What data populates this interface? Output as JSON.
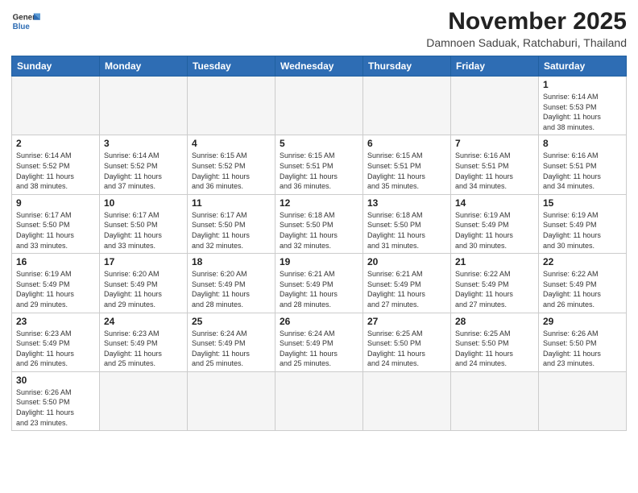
{
  "header": {
    "logo_line1": "General",
    "logo_line2": "Blue",
    "month_title": "November 2025",
    "location": "Damnoen Saduak, Ratchaburi, Thailand"
  },
  "weekdays": [
    "Sunday",
    "Monday",
    "Tuesday",
    "Wednesday",
    "Thursday",
    "Friday",
    "Saturday"
  ],
  "weeks": [
    [
      {
        "day": "",
        "info": ""
      },
      {
        "day": "",
        "info": ""
      },
      {
        "day": "",
        "info": ""
      },
      {
        "day": "",
        "info": ""
      },
      {
        "day": "",
        "info": ""
      },
      {
        "day": "",
        "info": ""
      },
      {
        "day": "1",
        "info": "Sunrise: 6:14 AM\nSunset: 5:53 PM\nDaylight: 11 hours\nand 38 minutes."
      }
    ],
    [
      {
        "day": "2",
        "info": "Sunrise: 6:14 AM\nSunset: 5:52 PM\nDaylight: 11 hours\nand 38 minutes."
      },
      {
        "day": "3",
        "info": "Sunrise: 6:14 AM\nSunset: 5:52 PM\nDaylight: 11 hours\nand 37 minutes."
      },
      {
        "day": "4",
        "info": "Sunrise: 6:15 AM\nSunset: 5:52 PM\nDaylight: 11 hours\nand 36 minutes."
      },
      {
        "day": "5",
        "info": "Sunrise: 6:15 AM\nSunset: 5:51 PM\nDaylight: 11 hours\nand 36 minutes."
      },
      {
        "day": "6",
        "info": "Sunrise: 6:15 AM\nSunset: 5:51 PM\nDaylight: 11 hours\nand 35 minutes."
      },
      {
        "day": "7",
        "info": "Sunrise: 6:16 AM\nSunset: 5:51 PM\nDaylight: 11 hours\nand 34 minutes."
      },
      {
        "day": "8",
        "info": "Sunrise: 6:16 AM\nSunset: 5:51 PM\nDaylight: 11 hours\nand 34 minutes."
      }
    ],
    [
      {
        "day": "9",
        "info": "Sunrise: 6:17 AM\nSunset: 5:50 PM\nDaylight: 11 hours\nand 33 minutes."
      },
      {
        "day": "10",
        "info": "Sunrise: 6:17 AM\nSunset: 5:50 PM\nDaylight: 11 hours\nand 33 minutes."
      },
      {
        "day": "11",
        "info": "Sunrise: 6:17 AM\nSunset: 5:50 PM\nDaylight: 11 hours\nand 32 minutes."
      },
      {
        "day": "12",
        "info": "Sunrise: 6:18 AM\nSunset: 5:50 PM\nDaylight: 11 hours\nand 32 minutes."
      },
      {
        "day": "13",
        "info": "Sunrise: 6:18 AM\nSunset: 5:50 PM\nDaylight: 11 hours\nand 31 minutes."
      },
      {
        "day": "14",
        "info": "Sunrise: 6:19 AM\nSunset: 5:49 PM\nDaylight: 11 hours\nand 30 minutes."
      },
      {
        "day": "15",
        "info": "Sunrise: 6:19 AM\nSunset: 5:49 PM\nDaylight: 11 hours\nand 30 minutes."
      }
    ],
    [
      {
        "day": "16",
        "info": "Sunrise: 6:19 AM\nSunset: 5:49 PM\nDaylight: 11 hours\nand 29 minutes."
      },
      {
        "day": "17",
        "info": "Sunrise: 6:20 AM\nSunset: 5:49 PM\nDaylight: 11 hours\nand 29 minutes."
      },
      {
        "day": "18",
        "info": "Sunrise: 6:20 AM\nSunset: 5:49 PM\nDaylight: 11 hours\nand 28 minutes."
      },
      {
        "day": "19",
        "info": "Sunrise: 6:21 AM\nSunset: 5:49 PM\nDaylight: 11 hours\nand 28 minutes."
      },
      {
        "day": "20",
        "info": "Sunrise: 6:21 AM\nSunset: 5:49 PM\nDaylight: 11 hours\nand 27 minutes."
      },
      {
        "day": "21",
        "info": "Sunrise: 6:22 AM\nSunset: 5:49 PM\nDaylight: 11 hours\nand 27 minutes."
      },
      {
        "day": "22",
        "info": "Sunrise: 6:22 AM\nSunset: 5:49 PM\nDaylight: 11 hours\nand 26 minutes."
      }
    ],
    [
      {
        "day": "23",
        "info": "Sunrise: 6:23 AM\nSunset: 5:49 PM\nDaylight: 11 hours\nand 26 minutes."
      },
      {
        "day": "24",
        "info": "Sunrise: 6:23 AM\nSunset: 5:49 PM\nDaylight: 11 hours\nand 25 minutes."
      },
      {
        "day": "25",
        "info": "Sunrise: 6:24 AM\nSunset: 5:49 PM\nDaylight: 11 hours\nand 25 minutes."
      },
      {
        "day": "26",
        "info": "Sunrise: 6:24 AM\nSunset: 5:49 PM\nDaylight: 11 hours\nand 25 minutes."
      },
      {
        "day": "27",
        "info": "Sunrise: 6:25 AM\nSunset: 5:50 PM\nDaylight: 11 hours\nand 24 minutes."
      },
      {
        "day": "28",
        "info": "Sunrise: 6:25 AM\nSunset: 5:50 PM\nDaylight: 11 hours\nand 24 minutes."
      },
      {
        "day": "29",
        "info": "Sunrise: 6:26 AM\nSunset: 5:50 PM\nDaylight: 11 hours\nand 23 minutes."
      }
    ],
    [
      {
        "day": "30",
        "info": "Sunrise: 6:26 AM\nSunset: 5:50 PM\nDaylight: 11 hours\nand 23 minutes."
      },
      {
        "day": "",
        "info": ""
      },
      {
        "day": "",
        "info": ""
      },
      {
        "day": "",
        "info": ""
      },
      {
        "day": "",
        "info": ""
      },
      {
        "day": "",
        "info": ""
      },
      {
        "day": "",
        "info": ""
      }
    ]
  ]
}
